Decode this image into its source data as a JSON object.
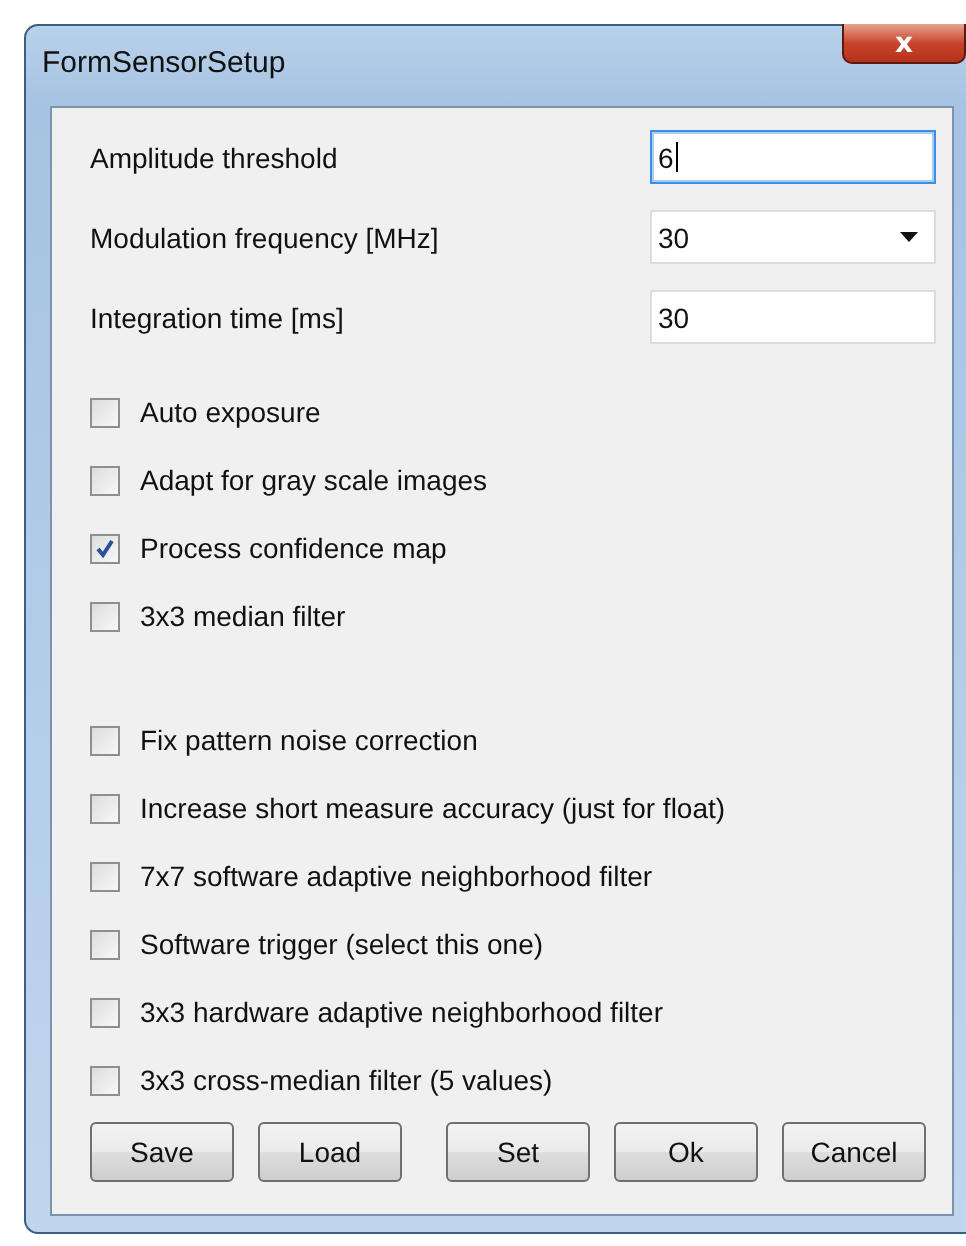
{
  "window": {
    "title": "FormSensorSetup",
    "close": "x"
  },
  "fields": [
    {
      "kind": "text",
      "label": "Amplitude threshold",
      "value": "6",
      "focused": true
    },
    {
      "kind": "combo",
      "label": "Modulation frequency [MHz]",
      "value": "30"
    },
    {
      "kind": "text",
      "label": "Integration time [ms]",
      "value": "30",
      "focused": false
    }
  ],
  "checkbox_groups": [
    [
      {
        "label": "Auto exposure",
        "checked": false
      },
      {
        "label": "Adapt for gray scale images",
        "checked": false
      },
      {
        "label": "Process confidence map",
        "checked": true
      },
      {
        "label": "3x3 median filter",
        "checked": false
      }
    ],
    [
      {
        "label": "Fix pattern noise correction",
        "checked": false
      },
      {
        "label": "Increase short measure accuracy (just for float)",
        "checked": false
      },
      {
        "label": "7x7 software adaptive neighborhood filter",
        "checked": false
      },
      {
        "label": "Software trigger (select this one)",
        "checked": false
      },
      {
        "label": "3x3 hardware adaptive neighborhood filter",
        "checked": false
      },
      {
        "label": "3x3 cross-median filter (5 values)",
        "checked": false
      }
    ]
  ],
  "buttons": [
    "Save",
    "Load",
    "Set",
    "Ok",
    "Cancel"
  ]
}
